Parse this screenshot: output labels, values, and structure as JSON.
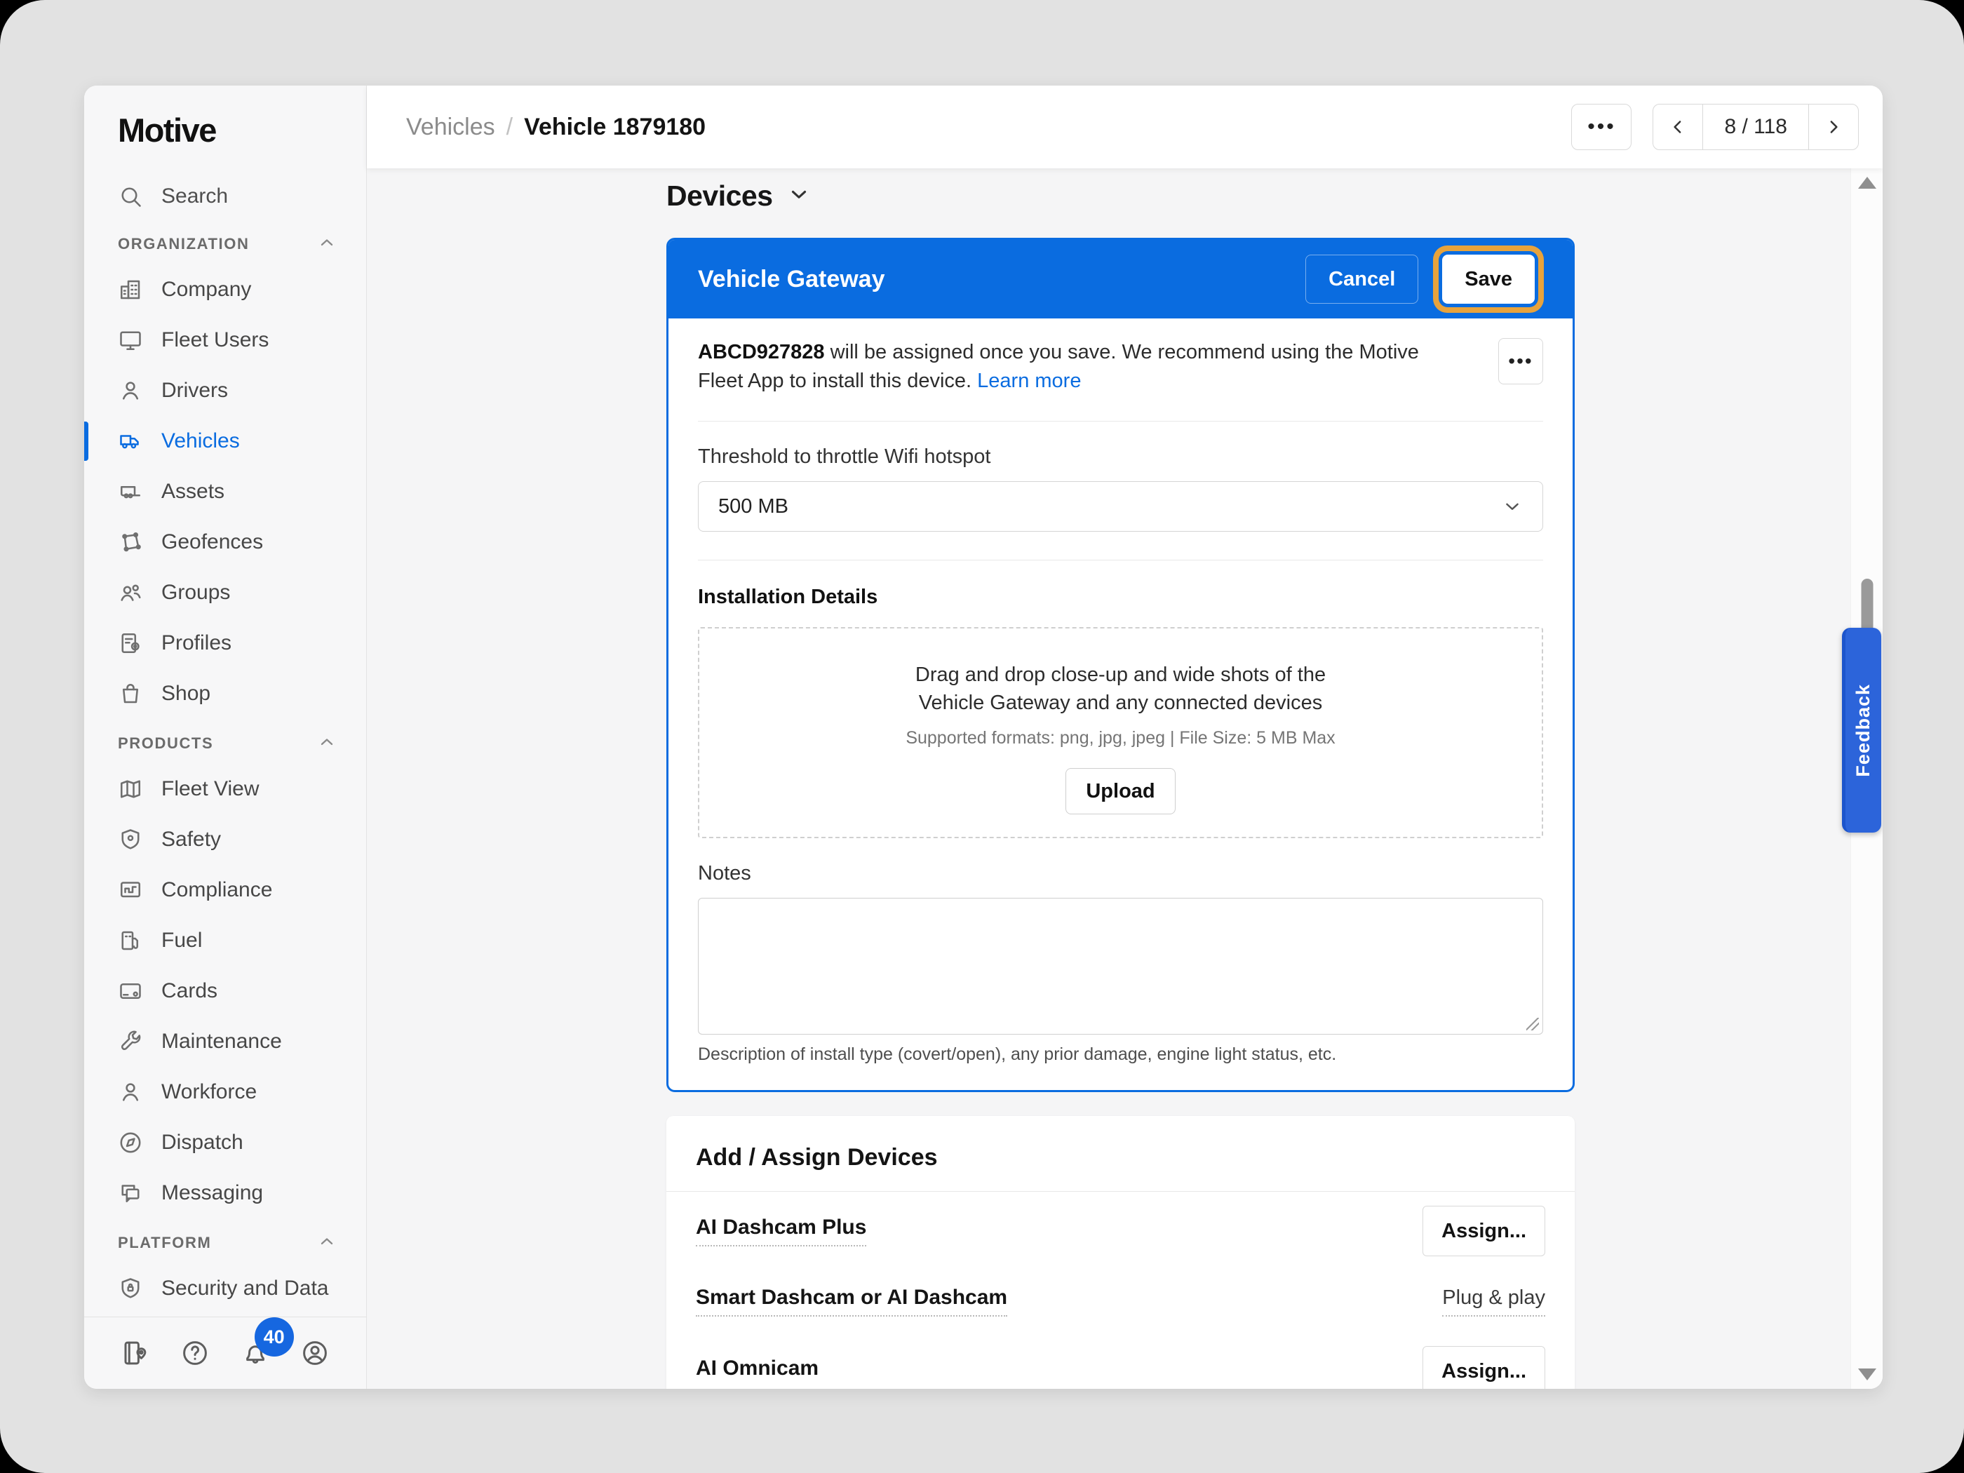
{
  "colors": {
    "accent": "#0a6ce0",
    "focus_ring": "#e8a33c",
    "badge_blue": "#1667e0"
  },
  "sidebar": {
    "logo": "Motive",
    "search_label": "Search",
    "sections": [
      {
        "label": "ORGANIZATION",
        "items": [
          {
            "label": "Company"
          },
          {
            "label": "Fleet Users"
          },
          {
            "label": "Drivers"
          },
          {
            "label": "Vehicles",
            "active": true
          },
          {
            "label": "Assets"
          },
          {
            "label": "Geofences"
          },
          {
            "label": "Groups"
          },
          {
            "label": "Profiles"
          },
          {
            "label": "Shop"
          }
        ]
      },
      {
        "label": "PRODUCTS",
        "items": [
          {
            "label": "Fleet View"
          },
          {
            "label": "Safety"
          },
          {
            "label": "Compliance"
          },
          {
            "label": "Fuel"
          },
          {
            "label": "Cards"
          },
          {
            "label": "Maintenance"
          },
          {
            "label": "Workforce"
          },
          {
            "label": "Dispatch"
          },
          {
            "label": "Messaging"
          }
        ]
      },
      {
        "label": "PLATFORM",
        "items": [
          {
            "label": "Security and Data"
          }
        ]
      }
    ],
    "notification_badge": "40"
  },
  "header": {
    "breadcrumb_parent": "Vehicles",
    "breadcrumb_separator": "/",
    "breadcrumb_current": "Vehicle 1879180",
    "more_label": "•••",
    "pager": {
      "label": "8 / 118",
      "current": "8",
      "separator": "/",
      "total": "118"
    }
  },
  "main": {
    "section_title": "Devices",
    "gateway_card": {
      "title": "Vehicle Gateway",
      "cancel_label": "Cancel",
      "save_label": "Save",
      "notice_serial": "ABCD927828",
      "notice_rest": " will be assigned once you save. We recommend using the Motive Fleet App to install this device. ",
      "learn_more_label": "Learn more",
      "more_label": "•••",
      "threshold_label": "Threshold to throttle Wifi hotspot",
      "threshold_value": "500 MB",
      "installation_details_label": "Installation Details",
      "dropzone_line1": "Drag and drop close-up and wide shots of the",
      "dropzone_line2": "Vehicle Gateway and any connected devices",
      "dropzone_formats": "Supported formats: png, jpg, jpeg | File Size: 5 MB Max",
      "upload_label": "Upload",
      "notes_label": "Notes",
      "notes_value": "",
      "notes_helper": "Description of install type (covert/open), any prior damage, engine light status, etc."
    },
    "assign_card": {
      "title": "Add / Assign Devices",
      "rows": [
        {
          "label": "AI Dashcam Plus",
          "action": "Assign..."
        },
        {
          "label": "Smart Dashcam or AI Dashcam",
          "action": "Plug & play"
        },
        {
          "label": "AI Omnicam",
          "action": "Assign..."
        }
      ]
    }
  },
  "feedback_tab": {
    "label": "Feedback"
  }
}
